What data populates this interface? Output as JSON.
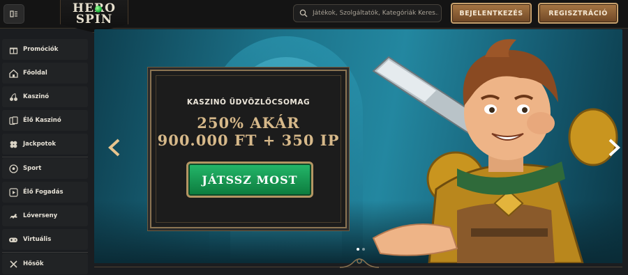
{
  "brand": {
    "line1": "HERO",
    "line2": "SPIN"
  },
  "header": {
    "search_placeholder": "Játékok, Szolgáltatók, Kategóriák Keres...",
    "login_label": "BEJELENTKEZÉS",
    "register_label": "REGISZTRÁCIÓ"
  },
  "sidebar": {
    "items": [
      {
        "label": "Promóciók",
        "icon": "gift-icon"
      },
      {
        "label": "Főoldal",
        "icon": "home-icon"
      },
      {
        "label": "Kaszinó",
        "icon": "cherries-icon"
      },
      {
        "label": "Élő Kaszinó",
        "icon": "cards-icon"
      },
      {
        "label": "Jackpotok",
        "icon": "clover-icon"
      },
      {
        "label": "Sport",
        "icon": "soccer-ball-icon"
      },
      {
        "label": "Élő Fogadás",
        "icon": "live-betting-icon"
      },
      {
        "label": "Lóverseny",
        "icon": "horse-icon"
      },
      {
        "label": "Virtuális",
        "icon": "gamepad-icon"
      },
      {
        "label": "Hősök",
        "icon": "crossed-swords-icon"
      }
    ]
  },
  "banner": {
    "subtitle": "KASZINÓ ÜDVÖZLŐCSOMAG",
    "headline_1": "250% AKÁR",
    "headline_2": "900.000 FT + 350 IP",
    "cta_label": "JÁTSSZ MOST",
    "slide_count": 2,
    "active_slide": 1
  },
  "colors": {
    "accent_gold": "#c8a26e",
    "cta_green": "#1a9d55",
    "background": "#1b1d20"
  }
}
